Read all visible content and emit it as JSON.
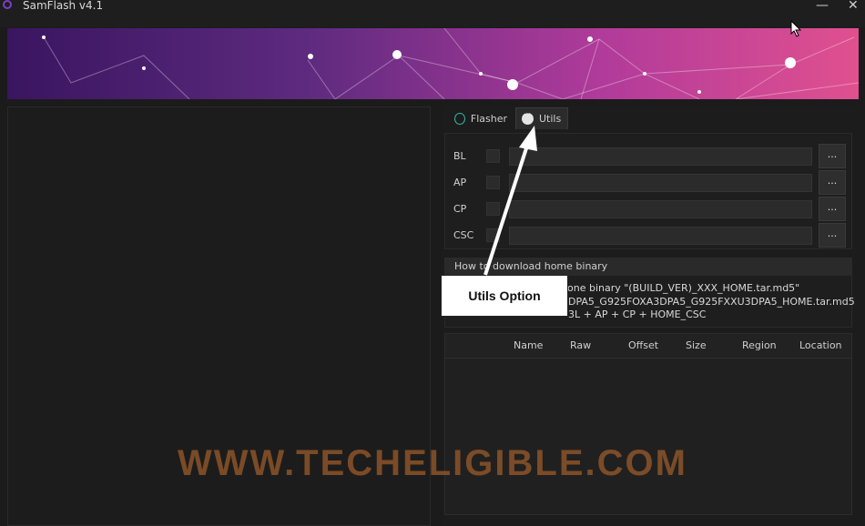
{
  "window": {
    "title": "SamFlash v4.1",
    "minimize_label": "—",
    "close_label": "✕"
  },
  "tabs": [
    {
      "label": "Flasher",
      "icon": "clock-icon"
    },
    {
      "label": "Utils",
      "icon": "ellipsis-icon"
    }
  ],
  "file_rows": [
    {
      "label": "BL",
      "browse": "..."
    },
    {
      "label": "AP",
      "browse": "..."
    },
    {
      "label": "CP",
      "browse": "..."
    },
    {
      "label": "CSC",
      "browse": "..."
    }
  ],
  "help": {
    "title": "How to download home binary",
    "lines": [
      "one binary \"(BUILD_VER)_XXX_HOME.tar.md5\"",
      "DPA5_G925FOXA3DPA5_G925FXXU3DPA5_HOME.tar.md5",
      "3L + AP + CP + HOME_CSC"
    ]
  },
  "table": {
    "columns": [
      "Name",
      "Raw",
      "Offset",
      "Size",
      "Region",
      "Location"
    ]
  },
  "annotation": {
    "callout_text": "Utils Option"
  },
  "watermark": "WWW.TECHELIGIBLE.COM",
  "colors": {
    "accent_purple": "#5d2a7f",
    "accent_pink": "#e0508f",
    "watermark": "#875228"
  }
}
